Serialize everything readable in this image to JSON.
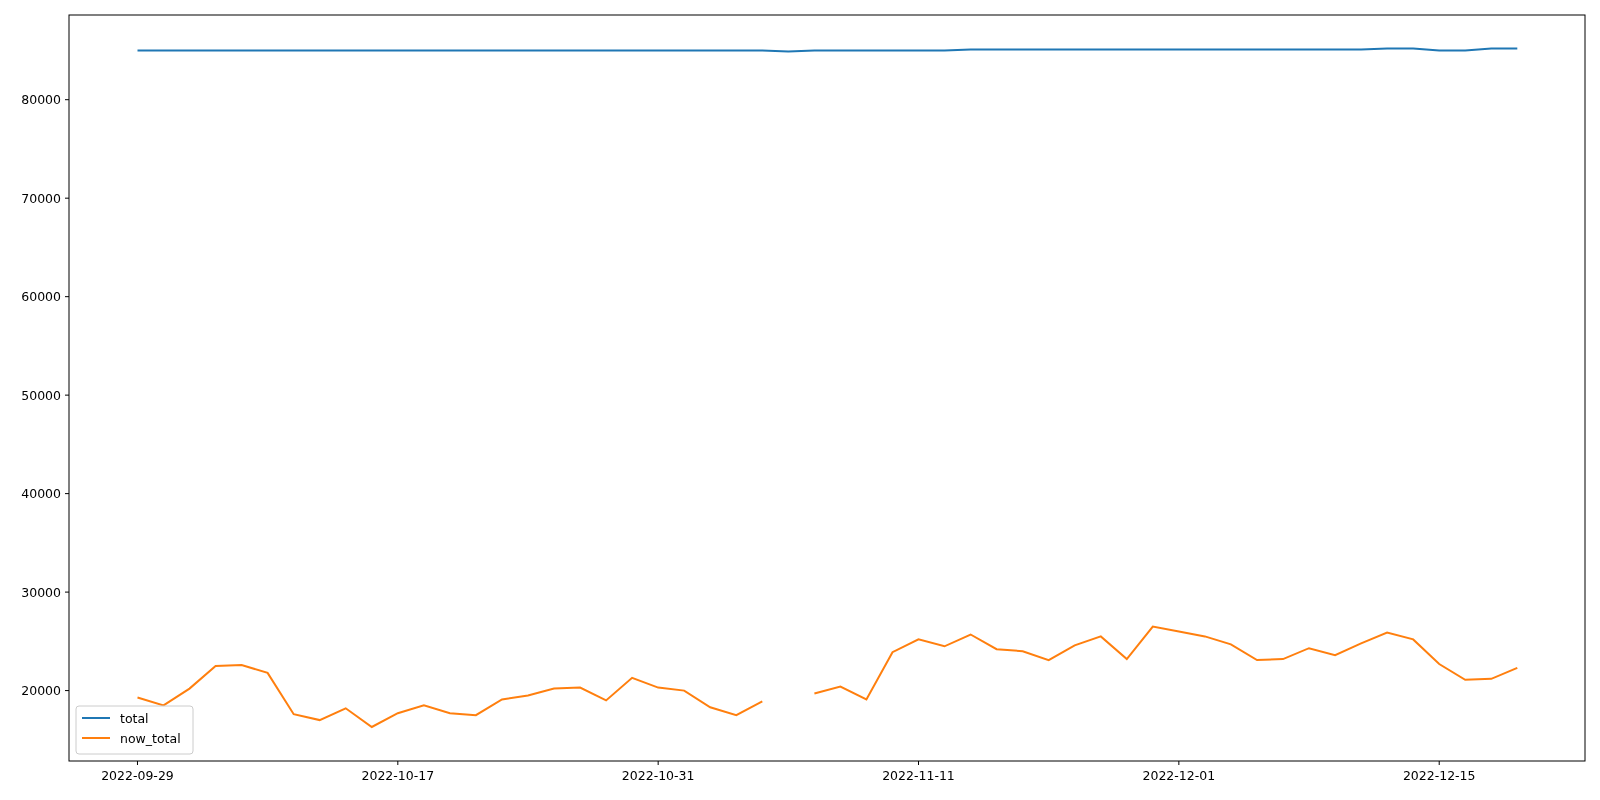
{
  "chart_data": {
    "type": "line",
    "categories": [
      "2022-09-29",
      null,
      null,
      null,
      null,
      null,
      null,
      null,
      null,
      null,
      "2022-10-17",
      null,
      null,
      null,
      null,
      null,
      null,
      null,
      null,
      null,
      "2022-10-31",
      null,
      null,
      null,
      null,
      null,
      null,
      null,
      null,
      null,
      "2022-11-11",
      null,
      null,
      null,
      null,
      null,
      null,
      null,
      null,
      null,
      "2022-12-01",
      null,
      null,
      null,
      null,
      null,
      null,
      null,
      null,
      null,
      "2022-12-15",
      null,
      null,
      null
    ],
    "ylim": [
      12850,
      88600
    ],
    "legend": true,
    "yticks": [
      20000,
      30000,
      40000,
      50000,
      60000,
      70000,
      80000
    ],
    "series": [
      {
        "name": "total",
        "color": "#1f77b4",
        "values": [
          85000,
          85000,
          85000,
          85000,
          85000,
          85000,
          85000,
          85000,
          85000,
          85000,
          85000,
          85000,
          85000,
          85000,
          85000,
          85000,
          85000,
          85000,
          85000,
          85000,
          85000,
          85000,
          85000,
          85000,
          85000,
          84900,
          85000,
          85000,
          85000,
          85000,
          85000,
          85000,
          85100,
          85100,
          85100,
          85100,
          85100,
          85100,
          85100,
          85100,
          85100,
          85100,
          85100,
          85100,
          85100,
          85100,
          85100,
          85100,
          85200,
          85200,
          85000,
          85000,
          85200,
          85200
        ]
      },
      {
        "name": "now_total",
        "color": "#ff7f0e",
        "values": [
          19300,
          18500,
          20200,
          22500,
          22600,
          21800,
          17600,
          17000,
          18200,
          16300,
          17700,
          18500,
          17700,
          17500,
          19100,
          19500,
          20200,
          20300,
          19000,
          21300,
          20300,
          20000,
          18300,
          17500,
          18900,
          null,
          19700,
          20400,
          19100,
          23900,
          25200,
          24500,
          25700,
          24200,
          24000,
          23100,
          24600,
          25500,
          23200,
          26500,
          26000,
          25500,
          24700,
          23100,
          23200,
          24300,
          23600,
          24800,
          25900,
          25200,
          22700,
          21100,
          21200,
          22300
        ]
      }
    ]
  }
}
